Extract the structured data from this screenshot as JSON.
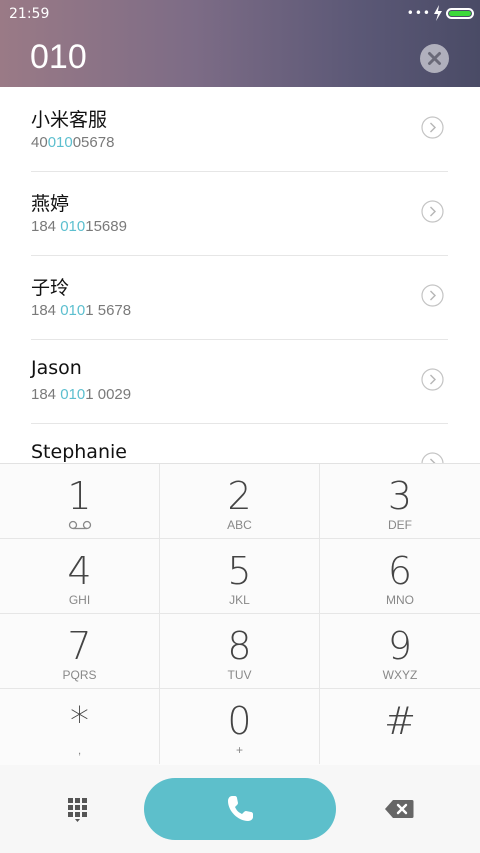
{
  "status": {
    "time": "21:59",
    "dots": "•••"
  },
  "dialer": {
    "input": "010"
  },
  "contacts": [
    {
      "name": "小米客服",
      "num_pre": "40",
      "num_match": "010",
      "num_post": "05678"
    },
    {
      "name": "燕婷",
      "num_pre": "184 ",
      "num_match": "010",
      "num_post": "15689"
    },
    {
      "name": "子玲",
      "num_pre": "184 ",
      "num_match": "010",
      "num_post": "1 5678"
    },
    {
      "name": "Jason",
      "num_pre": "184 ",
      "num_match": "010",
      "num_post": "1 0029"
    },
    {
      "name": "Stephanie",
      "num_pre": "",
      "num_match": "",
      "num_post": ""
    }
  ],
  "keys": [
    {
      "digit": "1",
      "letters": ""
    },
    {
      "digit": "2",
      "letters": "ABC"
    },
    {
      "digit": "3",
      "letters": "DEF"
    },
    {
      "digit": "4",
      "letters": "GHI"
    },
    {
      "digit": "5",
      "letters": "JKL"
    },
    {
      "digit": "6",
      "letters": "MNO"
    },
    {
      "digit": "7",
      "letters": "PQRS"
    },
    {
      "digit": "8",
      "letters": "TUV"
    },
    {
      "digit": "9",
      "letters": "WXYZ"
    },
    {
      "digit": "*",
      "letters": ","
    },
    {
      "digit": "0",
      "letters": "+"
    },
    {
      "digit": "#",
      "letters": ""
    }
  ],
  "icons": {
    "voicemail": "voicemail-icon",
    "clear": "clear-icon",
    "detail": "chevron-right-icon",
    "call": "phone-icon",
    "keypad": "dialpad-icon",
    "backspace": "backspace-icon"
  },
  "colors": {
    "accent": "#5dbfcb",
    "highlight": "#5cbfcf",
    "battery": "#3dd93a"
  }
}
